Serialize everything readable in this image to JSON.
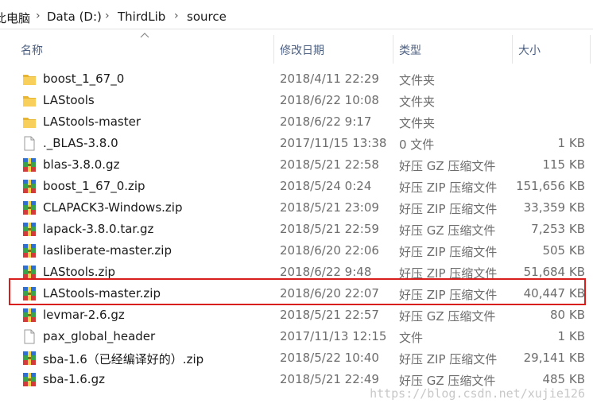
{
  "breadcrumb": {
    "items": [
      "此电脑",
      "Data (D:)",
      "ThirdLib",
      "source"
    ],
    "separator": "›"
  },
  "columns": {
    "name": "名称",
    "date": "修改日期",
    "type": "类型",
    "size": "大小"
  },
  "files": [
    {
      "name": "boost_1_67_0",
      "date": "2018/4/11 22:29",
      "type": "文件夹",
      "size": "",
      "icon": "folder-icon"
    },
    {
      "name": "LAStools",
      "date": "2018/6/22 10:08",
      "type": "文件夹",
      "size": "",
      "icon": "folder-icon"
    },
    {
      "name": "LAStools-master",
      "date": "2018/6/22 9:17",
      "type": "文件夹",
      "size": "",
      "icon": "folder-icon"
    },
    {
      "name": "._BLAS-3.8.0",
      "date": "2017/11/15 13:38",
      "type": "0 文件",
      "size": "1 KB",
      "icon": "file-icon"
    },
    {
      "name": "blas-3.8.0.gz",
      "date": "2018/5/21 22:58",
      "type": "好压 GZ 压缩文件",
      "size": "115 KB",
      "icon": "archive-icon"
    },
    {
      "name": "boost_1_67_0.zip",
      "date": "2018/5/24 0:24",
      "type": "好压 ZIP 压缩文件",
      "size": "151,656 KB",
      "icon": "archive-icon"
    },
    {
      "name": "CLAPACK3-Windows.zip",
      "date": "2018/5/21 23:09",
      "type": "好压 ZIP 压缩文件",
      "size": "33,359 KB",
      "icon": "archive-icon"
    },
    {
      "name": "lapack-3.8.0.tar.gz",
      "date": "2018/5/21 22:59",
      "type": "好压 GZ 压缩文件",
      "size": "7,253 KB",
      "icon": "archive-icon"
    },
    {
      "name": "lasliberate-master.zip",
      "date": "2018/6/20 22:06",
      "type": "好压 ZIP 压缩文件",
      "size": "505 KB",
      "icon": "archive-icon"
    },
    {
      "name": "LAStools.zip",
      "date": "2018/6/22 9:48",
      "type": "好压 ZIP 压缩文件",
      "size": "51,684 KB",
      "icon": "archive-icon"
    },
    {
      "name": "LAStools-master.zip",
      "date": "2018/6/20 22:07",
      "type": "好压 ZIP 压缩文件",
      "size": "40,447 KB",
      "icon": "archive-icon"
    },
    {
      "name": "levmar-2.6.gz",
      "date": "2018/5/21 22:57",
      "type": "好压 GZ 压缩文件",
      "size": "80 KB",
      "icon": "archive-icon"
    },
    {
      "name": "pax_global_header",
      "date": "2017/11/13 12:15",
      "type": "文件",
      "size": "1 KB",
      "icon": "file-icon"
    },
    {
      "name": "sba-1.6（已经编译好的）.zip",
      "date": "2018/5/22 10:40",
      "type": "好压 ZIP 压缩文件",
      "size": "29,141 KB",
      "icon": "archive-icon"
    },
    {
      "name": "sba-1.6.gz",
      "date": "2018/5/21 22:49",
      "type": "好压 GZ 压缩文件",
      "size": "485 KB",
      "icon": "archive-icon"
    }
  ],
  "watermark": "https://blog.csdn.net/xujie126",
  "colors": {
    "highlight_border": "#d91e1e",
    "folder": "#f5c542",
    "archive_blue": "#2f6fd1",
    "archive_green": "#3aa34a",
    "archive_red": "#d43a3a",
    "header_text": "#4d6082"
  }
}
